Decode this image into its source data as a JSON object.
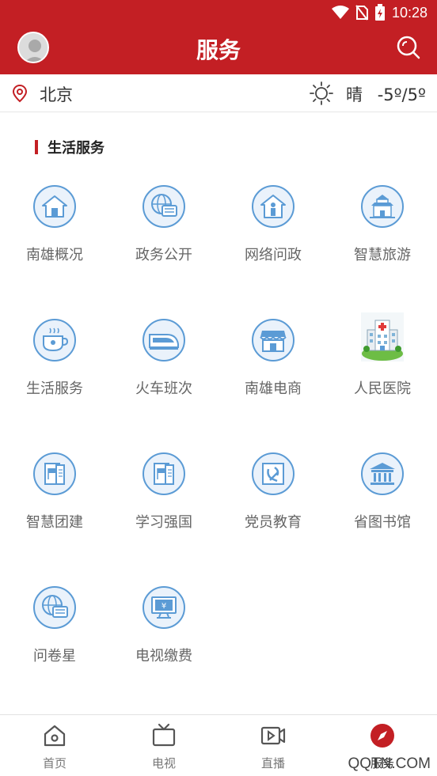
{
  "status_bar": {
    "time": "10:28"
  },
  "header": {
    "title": "服务"
  },
  "location_bar": {
    "city": "北京",
    "weather_text": "晴",
    "temperature": "-5º/5º"
  },
  "section": {
    "title": "生活服务"
  },
  "services": [
    {
      "label": "南雄概况",
      "icon": "house-icon"
    },
    {
      "label": "政务公开",
      "icon": "globe-chat-icon"
    },
    {
      "label": "网络问政",
      "icon": "house-person-icon"
    },
    {
      "label": "智慧旅游",
      "icon": "temple-icon"
    },
    {
      "label": "生活服务",
      "icon": "teacup-icon"
    },
    {
      "label": "火车班次",
      "icon": "train-icon"
    },
    {
      "label": "南雄电商",
      "icon": "store-icon"
    },
    {
      "label": "人民医院",
      "icon": "hospital-icon"
    },
    {
      "label": "智慧团建",
      "icon": "flag-book-icon"
    },
    {
      "label": "学习强国",
      "icon": "flag-book-icon"
    },
    {
      "label": "党员教育",
      "icon": "party-emblem-icon"
    },
    {
      "label": "省图书馆",
      "icon": "library-icon"
    },
    {
      "label": "问卷星",
      "icon": "globe-chat-icon"
    },
    {
      "label": "电视缴费",
      "icon": "tv-payment-icon"
    }
  ],
  "tabbar": {
    "items": [
      {
        "label": "首页",
        "icon": "home-icon"
      },
      {
        "label": "电视",
        "icon": "tv-icon"
      },
      {
        "label": "直播",
        "icon": "video-icon"
      },
      {
        "label": "服务",
        "icon": "compass-icon",
        "active": true
      }
    ]
  },
  "watermark": "QQTN.COM",
  "colors": {
    "brand_red": "#c31f24",
    "icon_blue": "#5b9bd5",
    "icon_fill": "#eaf2fb"
  }
}
